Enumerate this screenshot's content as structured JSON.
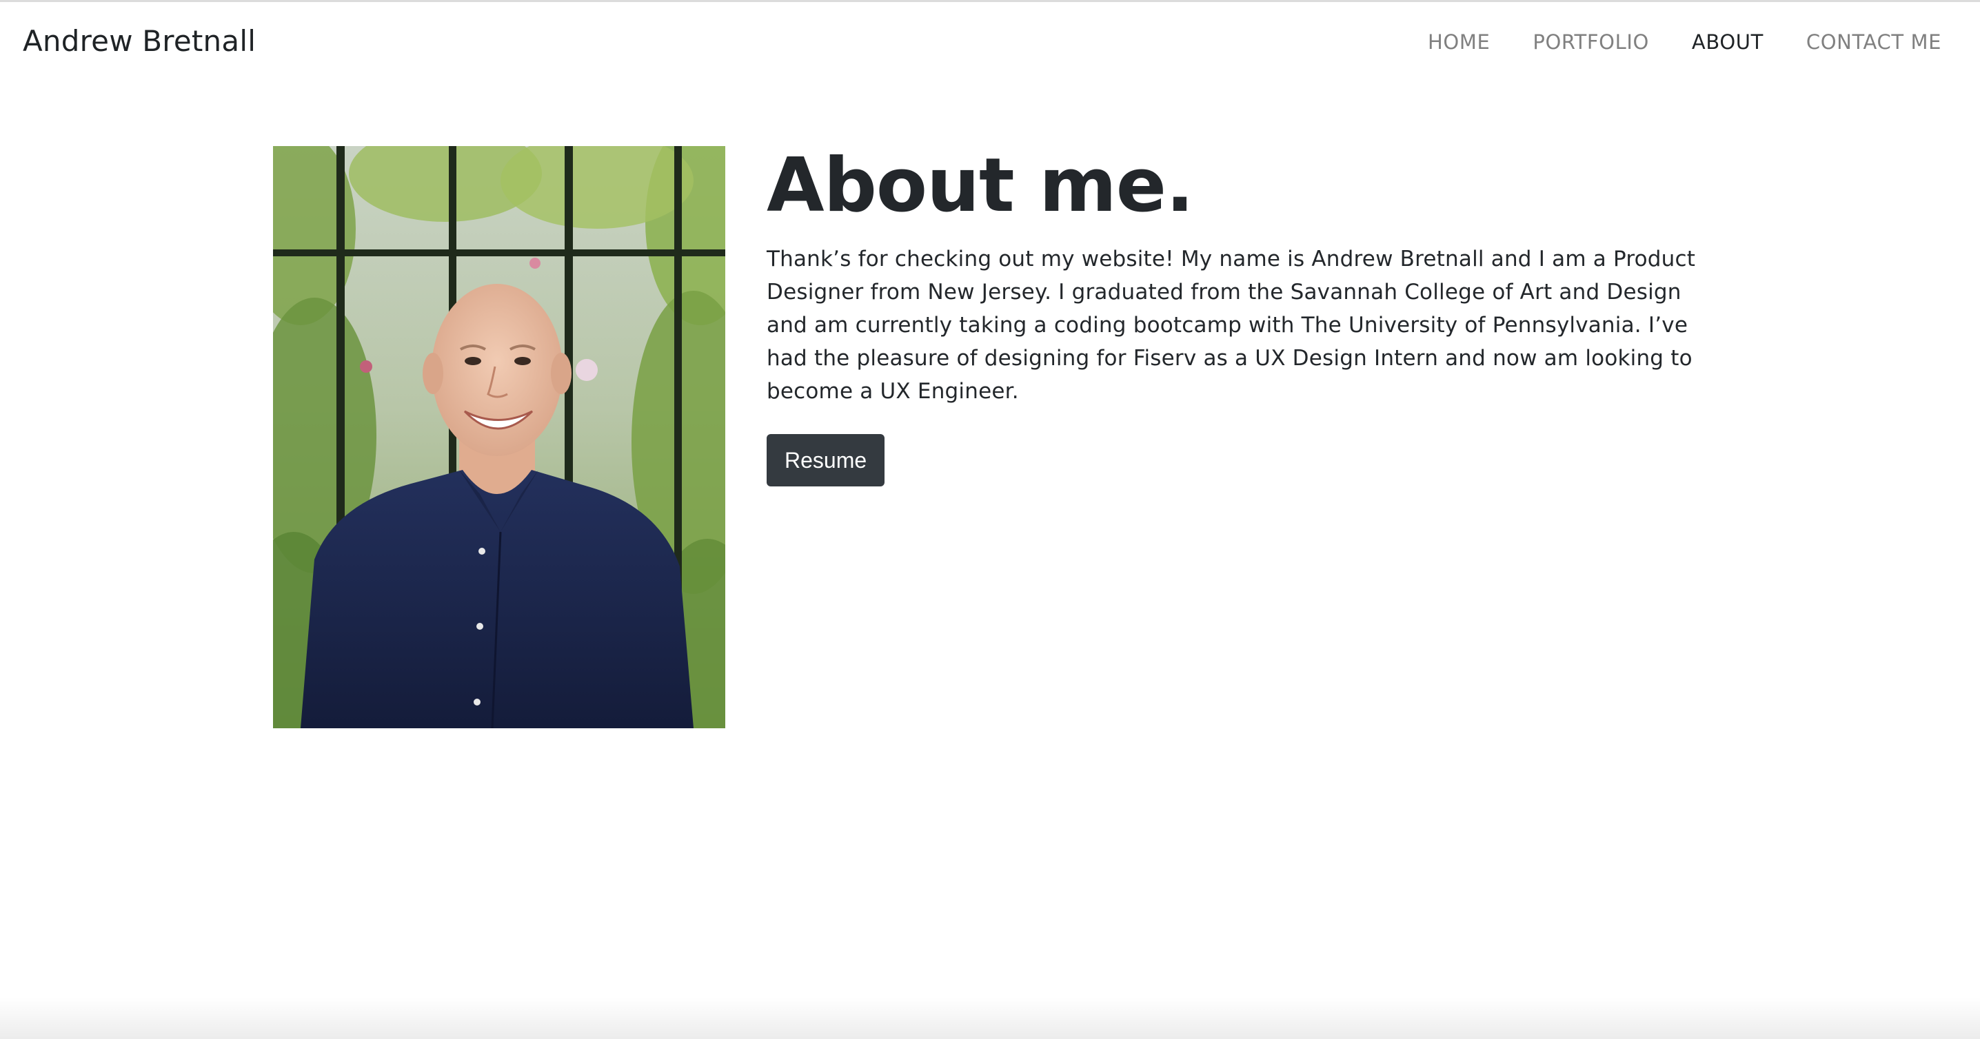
{
  "navbar": {
    "brand": "Andrew Bretnall",
    "links": [
      {
        "label": "HOME",
        "active": false
      },
      {
        "label": "PORTFOLIO",
        "active": false
      },
      {
        "label": "ABOUT",
        "active": true
      },
      {
        "label": "CONTACT ME",
        "active": false
      }
    ]
  },
  "about": {
    "title": "About me.",
    "body": "Thank’s for checking out my website! My name is Andrew Bretnall and I am a Product Designer from New Jersey. I graduated from the Savannah College of Art and Design and am currently taking a coding bootcamp with The University of Pennsylvania. I’ve had the pleasure of designing for Fiserv as a UX Design Intern and now am looking to become a UX Engineer.",
    "resume_label": "Resume"
  },
  "colors": {
    "text": "#212529",
    "nav_inactive": "#808080",
    "button_bg": "#343a40",
    "button_text": "#ffffff"
  }
}
